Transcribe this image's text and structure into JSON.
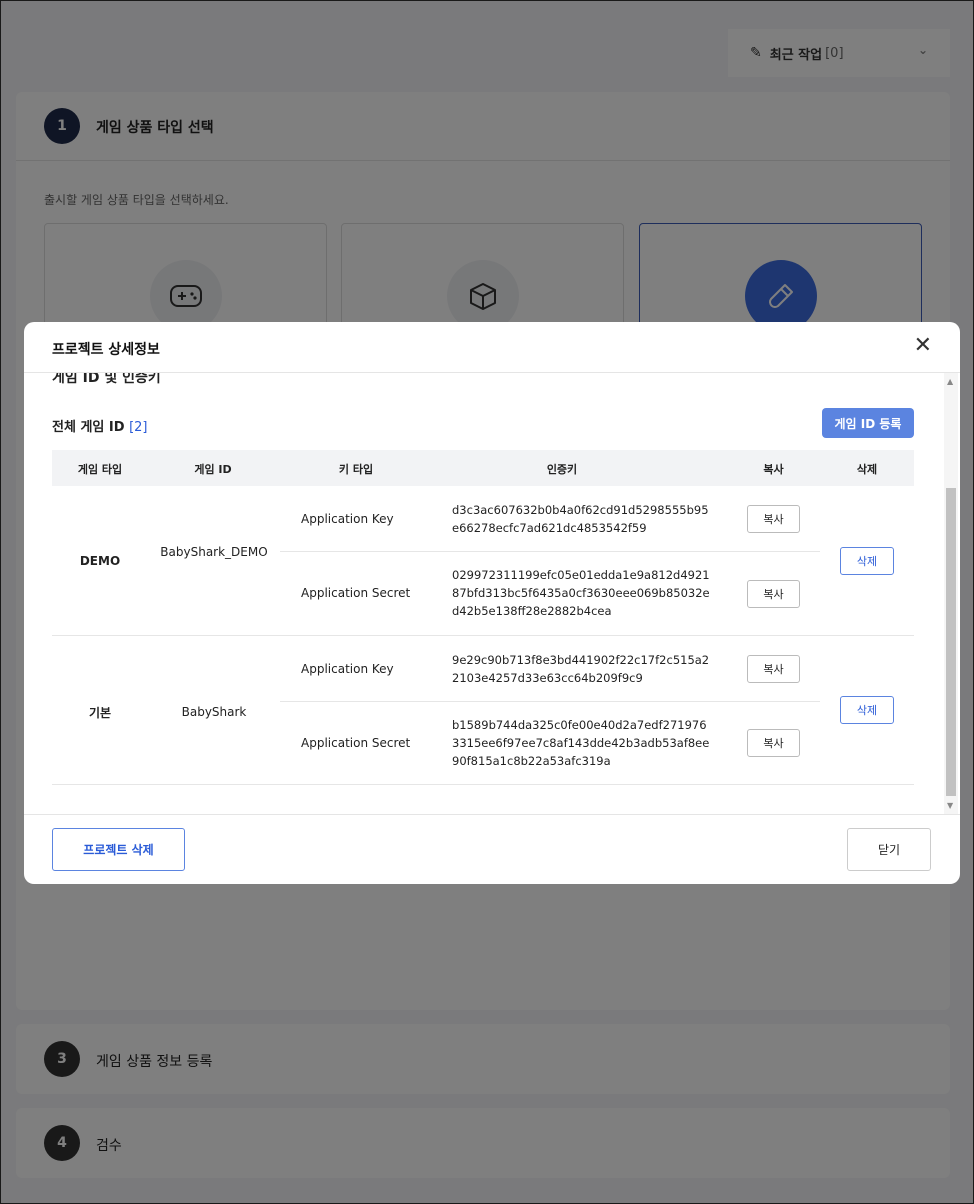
{
  "recent": {
    "icon": "pencil-icon",
    "label": "최근 작업",
    "count": "[0]"
  },
  "steps": {
    "step1": {
      "num": "1",
      "title": "게임 상품 타입 선택",
      "desc": "출시할 게임 상품 타입을 선택하세요."
    },
    "step3": {
      "num": "3",
      "title": "게임 상품 정보 등록"
    },
    "step4": {
      "num": "4",
      "title": "검수"
    }
  },
  "type_icons": [
    "gamepad-icon",
    "box-icon",
    "test-tube-icon"
  ],
  "modal": {
    "title": "프로젝트 상세정보",
    "section_title": "게임 ID 및 인증키",
    "all_ids_label": "전체 게임 ID",
    "all_ids_count": "[2]",
    "register_button": "게임 ID 등록",
    "headers": [
      "게임 타입",
      "게임 ID",
      "키 타입",
      "인증키",
      "복사",
      "삭제"
    ],
    "rows": [
      {
        "game_type": "DEMO",
        "game_id": "BabyShark_DEMO",
        "keys": [
          {
            "key_type": "Application Key",
            "key": "d3c3ac607632b0b4a0f62cd91d5298555b95e66278ecfc7ad621dc4853542f59",
            "copy": "복사"
          },
          {
            "key_type": "Application Secret",
            "key": "029972311199efc05e01edda1e9a812d492187bfd313bc5f6435a0cf3630eee069b85032ed42b5e138ff28e2882b4cea",
            "copy": "복사"
          }
        ],
        "delete": "삭제"
      },
      {
        "game_type": "기본",
        "game_id": "BabyShark",
        "keys": [
          {
            "key_type": "Application Key",
            "key": "9e29c90b713f8e3bd441902f22c17f2c515a22103e4257d33e63cc64b209f9c9",
            "copy": "복사"
          },
          {
            "key_type": "Application Secret",
            "key": "b1589b744da325c0fe00e40d2a7edf2719763315ee6f97ee7c8af143dde42b3adb53af8ee90f815a1c8b22a53afc319a",
            "copy": "복사"
          }
        ],
        "delete": "삭제"
      }
    ],
    "delete_project_button": "프로젝트 삭제",
    "close_button": "닫기"
  }
}
